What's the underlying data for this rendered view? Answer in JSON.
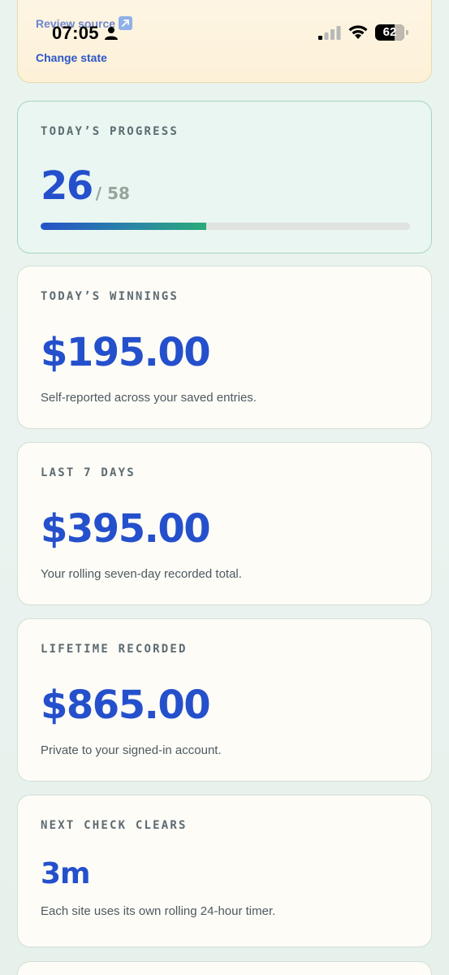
{
  "status_bar": {
    "time": "07:05",
    "battery": "62"
  },
  "top_card": {
    "review_source": "Review source",
    "change_state": "Change state"
  },
  "cards": {
    "progress": {
      "label": "TODAY’S PROGRESS",
      "value": "26",
      "total": "/ 58",
      "fraction": 0.448
    },
    "winnings": {
      "label": "TODAY’S WINNINGS",
      "value": "$195.00",
      "sub": "Self-reported across your saved entries."
    },
    "last7": {
      "label": "LAST 7 DAYS",
      "value": "$395.00",
      "sub": "Your rolling seven-day recorded total."
    },
    "lifetime": {
      "label": "LIFETIME RECORDED",
      "value": "$865.00",
      "sub": "Private to your signed-in account."
    },
    "next_check": {
      "label": "NEXT CHECK CLEARS",
      "value": "3m",
      "sub": "Each site uses its own rolling 24-hour timer."
    }
  },
  "colors": {
    "accent": "#2550cc",
    "progress_start": "#2552c9",
    "progress_end": "#2aab7a"
  }
}
